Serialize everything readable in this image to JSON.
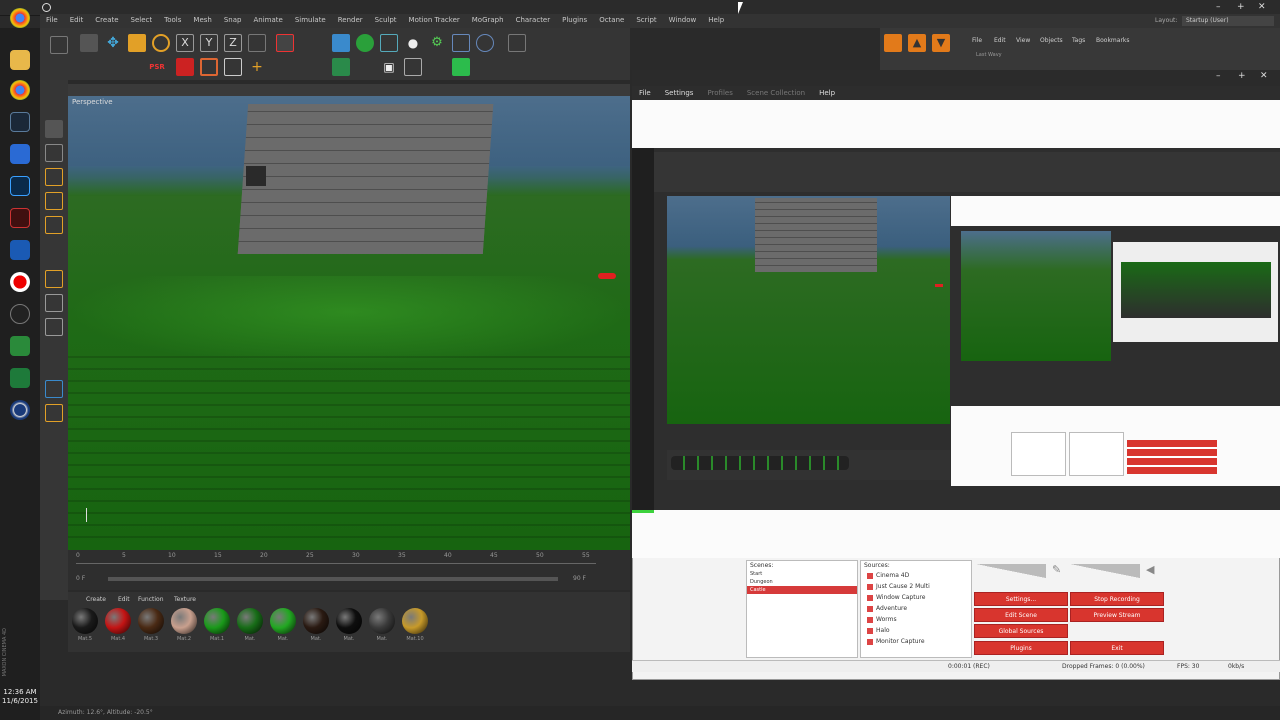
{
  "c4d": {
    "menu": [
      "File",
      "Edit",
      "Create",
      "Select",
      "Tools",
      "Mesh",
      "Snap",
      "Animate",
      "Simulate",
      "Render",
      "Sculpt",
      "Motion Tracker",
      "MoGraph",
      "Character",
      "Plugins",
      "Octane",
      "Script",
      "Window",
      "Help"
    ],
    "layout_label": "Layout:",
    "layout_value": "Startup (User)",
    "viewport_label": "Perspective",
    "timeline_ticks": [
      "0",
      "5",
      "10",
      "15",
      "20",
      "25",
      "30",
      "35",
      "40",
      "45",
      "50",
      "55"
    ],
    "timeline_start": "0 F",
    "timeline_end": "90 F",
    "mat_menu": [
      "Create",
      "Edit",
      "Function",
      "Texture"
    ],
    "materials": [
      {
        "label": "Mat.5",
        "color": "#1a1a1a"
      },
      {
        "label": "Mat.4",
        "color": "#c41414"
      },
      {
        "label": "Mat.3",
        "color": "#4a2a14"
      },
      {
        "label": "Mat.2",
        "color": "#c9a08e"
      },
      {
        "label": "Mat.1",
        "color": "#1a9a1a"
      },
      {
        "label": "Mat.",
        "color": "#176d17"
      },
      {
        "label": "Mat.",
        "color": "#22a822"
      },
      {
        "label": "Mat.",
        "color": "#2a1a12"
      },
      {
        "label": "Mat.",
        "color": "#0e0e0e"
      },
      {
        "label": "Mat.",
        "color": "#3a3a3a"
      },
      {
        "label": "Mat.10",
        "color": "#c79a2a"
      }
    ],
    "status_text": "Azimuth: 12.6°, Altitude: -20.5°",
    "right_panel_menu": [
      "File",
      "Edit",
      "View",
      "Objects",
      "Tags",
      "Bookmarks"
    ],
    "right_panel_item": "Last Wavy"
  },
  "obs": {
    "menu": [
      "File",
      "Settings",
      "Profiles",
      "Scene Collection",
      "Help"
    ],
    "scenes_header": "Scenes:",
    "scenes": [
      "Start",
      "Dungeon",
      "Castle"
    ],
    "selected_scene_index": 2,
    "sources_header": "Sources:",
    "sources": [
      "Cinema 4D",
      "Just Cause 2 Multi",
      "Window Capture",
      "Adventure",
      "Worms",
      "Halo",
      "Monitor Capture"
    ],
    "buttons": {
      "settings": "Settings...",
      "stop_recording": "Stop Recording",
      "edit_scene": "Edit Scene",
      "preview_stream": "Preview Stream",
      "global_sources": "Global Sources",
      "plugins": "Plugins",
      "exit": "Exit"
    },
    "status": {
      "time": "0:00:01 (REC)",
      "dropped": "Dropped Frames: 0 (0.00%)",
      "fps": "FPS: 30",
      "kbps": "0kb/s"
    }
  },
  "taskbar": {
    "time": "12:36 AM",
    "date": "11/6/2015",
    "brand": "MAXON CINEMA 4D"
  }
}
